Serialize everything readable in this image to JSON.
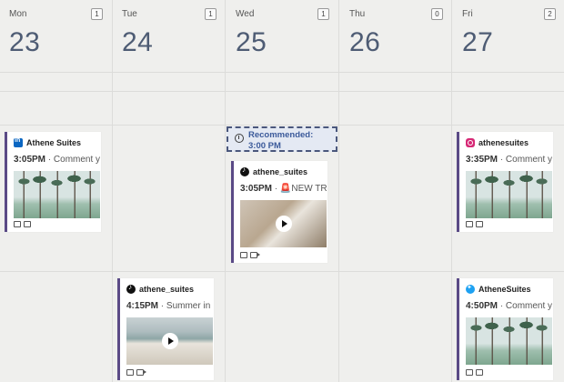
{
  "days": [
    {
      "name": "Mon",
      "date": "23",
      "count": "1"
    },
    {
      "name": "Tue",
      "date": "24",
      "count": "1"
    },
    {
      "name": "Wed",
      "date": "25",
      "count": "1"
    },
    {
      "name": "Thu",
      "date": "26",
      "count": "0"
    },
    {
      "name": "Fri",
      "date": "27",
      "count": "2"
    }
  ],
  "recommended": {
    "label": "Recommended:",
    "time": "3:00 PM"
  },
  "posts": {
    "mon_1": {
      "network_icon": "linkedin-icon",
      "account": "Athene Suites",
      "time": "3:05PM",
      "text": "· Comment y",
      "media": "image"
    },
    "wed_1": {
      "network_icon": "tiktok-icon",
      "account": "athene_suites",
      "time": "3:05PM",
      "text": "· 🚨NEW TRE",
      "media": "video"
    },
    "fri_1": {
      "network_icon": "instagram-icon",
      "account": "athenesuites",
      "time": "3:35PM",
      "text": "· Comment y",
      "media": "image"
    },
    "tue_1": {
      "network_icon": "tiktok-icon",
      "account": "athene_suites",
      "time": "4:15PM",
      "text": "· Summer in",
      "media": "video"
    },
    "fri_2": {
      "network_icon": "twitter-icon",
      "account": "AtheneSuites",
      "time": "4:50PM",
      "text": "· Comment y",
      "media": "image"
    }
  },
  "colors": {
    "accent_border": "#5a4a86",
    "day_number": "#4e5c74",
    "recommended": "#3b5a9a"
  }
}
